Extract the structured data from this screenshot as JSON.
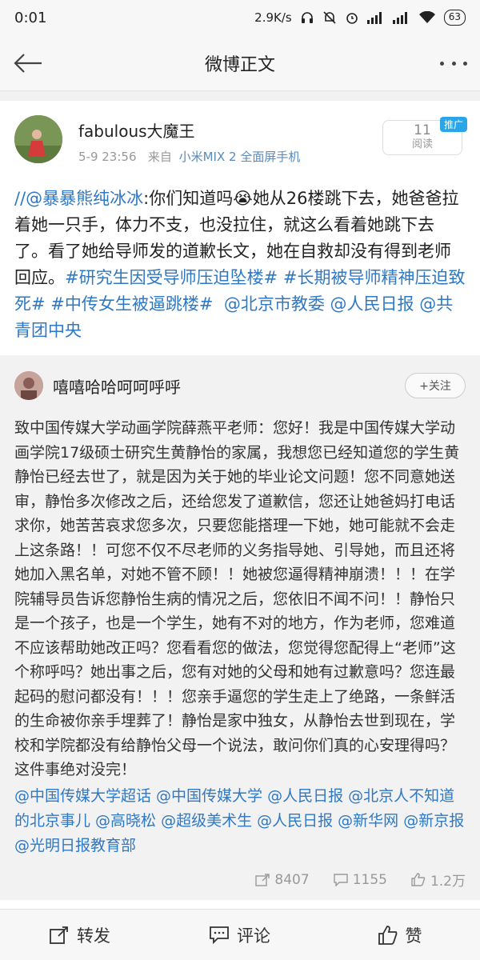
{
  "status": {
    "time": "0:01",
    "net_speed": "2.9K/s",
    "battery": "63"
  },
  "nav": {
    "title": "微博正文"
  },
  "post": {
    "author": "fabulous大魔王",
    "date": "5-9 23:56",
    "source_prefix": "来自",
    "device": "小米MIX 2 全面屏手机",
    "reads": "11",
    "reads_label": "阅读",
    "ad_tag": "推广",
    "body_mention": "//@暴暴熊纯冰冰",
    "body_text": ":你们知道吗😭她从26楼跳下去，她爸爸拉着她一只手，体力不支，也没拉住，就这么看着她跳下去了。看了她给导师发的道歉长文，她在自救却没有得到老师回应。",
    "tag1": "#研究生因受导师压迫坠楼#",
    "tag2": "#长期被导师精神压迫致死#",
    "tag3": "#中传女生被逼跳楼#",
    "mention1": "@北京市教委",
    "mention2": "@人民日报",
    "mention3": "@共青团中央"
  },
  "quote": {
    "author": "嘻嘻哈哈呵呵呼呼",
    "follow": "+关注",
    "body": "致中国传媒大学动画学院薛燕平老师：您好！我是中国传媒大学动画学院17级硕士研究生黄静怡的家属，我想您已经知道您的学生黄静怡已经去世了，就是因为关于她的毕业论文问题！您不同意她送审，静怡多次修改之后，还给您发了道歉信，您还让她爸妈打电话求你，她苦苦哀求您多次，只要您能搭理一下她，她可能就不会走上这条路！！可您不仅不尽老师的义务指导她、引导她，而且还将她加入黑名单，对她不管不顾！！她被您逼得精神崩溃！！！在学院辅导员告诉您静怡生病的情况之后，您依旧不闻不问！！静怡只是一个孩子，也是一个学生，她有不对的地方，作为老师，您难道不应该帮助她改正吗？您看看您的做法，您觉得您配得上“老师”这个称呼吗？她出事之后，您有对她的父母和她有过歉意吗？您连最起码的慰问都没有！！！您亲手逼您的学生走上了绝路，一条鲜活的生命被你亲手埋葬了！静怡是家中独女，从静怡去世到现在，学校和学院都没有给静怡父母一个说法，敢问你们真的心安理得吗？这件事绝对没完！",
    "links": "@中国传媒大学超话 @中国传媒大学 @人民日报 @北京人不知道的北京事儿 @高晓松 @超级美术生 @人民日报 @新华网 @新京报@光明日报教育部",
    "reposts": "8407",
    "comments": "1155",
    "likes": "1.2万"
  },
  "bottom": {
    "repost": "转发",
    "comment": "评论",
    "like": "赞"
  }
}
